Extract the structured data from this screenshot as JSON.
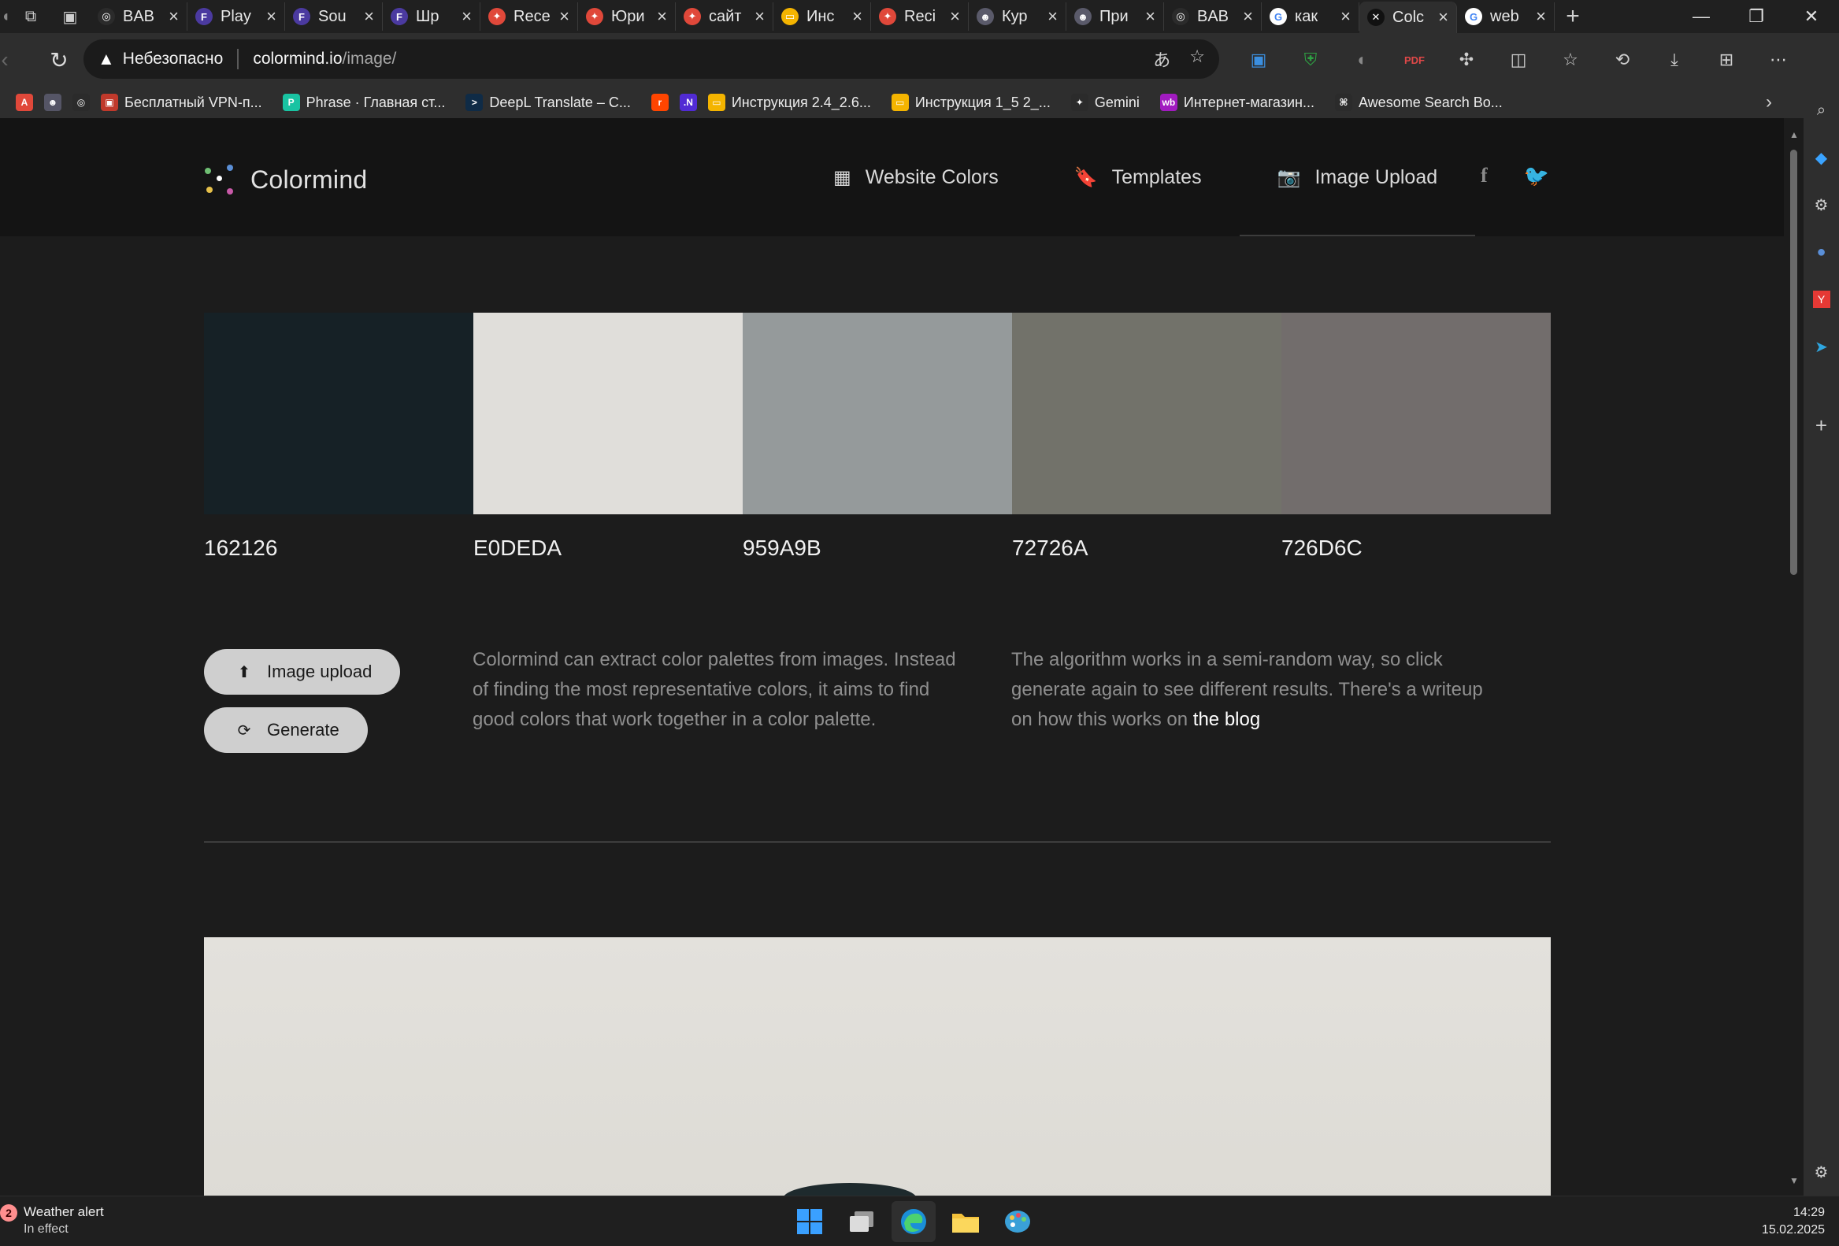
{
  "browser": {
    "tabs": [
      {
        "title": "BAB",
        "fav_color": "#2b2b2b",
        "fav_glyph": "◎",
        "fav_icon": "globe-icon"
      },
      {
        "title": "Play",
        "fav_color": "#4b3aa0",
        "fav_glyph": "F",
        "fav_icon": "framer-icon"
      },
      {
        "title": "Sou",
        "fav_color": "#4b3aa0",
        "fav_glyph": "F",
        "fav_icon": "framer-icon"
      },
      {
        "title": "Шр",
        "fav_color": "#4b3aa0",
        "fav_glyph": "F",
        "fav_icon": "framer-icon"
      },
      {
        "title": "Rece",
        "fav_color": "#e0483a",
        "fav_glyph": "✦",
        "fav_icon": "figma-icon"
      },
      {
        "title": "Юри",
        "fav_color": "#e0483a",
        "fav_glyph": "✦",
        "fav_icon": "figma-icon"
      },
      {
        "title": "сайт",
        "fav_color": "#e0483a",
        "fav_glyph": "✦",
        "fav_icon": "figma-icon"
      },
      {
        "title": "Инс",
        "fav_color": "#f4b400",
        "fav_glyph": "▭",
        "fav_icon": "slides-icon"
      },
      {
        "title": "Reci",
        "fav_color": "#e0483a",
        "fav_glyph": "✦",
        "fav_icon": "figma-icon"
      },
      {
        "title": "Кур",
        "fav_color": "#5a5a6a",
        "fav_glyph": "☻",
        "fav_icon": "mascot-icon"
      },
      {
        "title": "При",
        "fav_color": "#5a5a6a",
        "fav_glyph": "☻",
        "fav_icon": "mascot-icon"
      },
      {
        "title": "BAB",
        "fav_color": "#2b2b2b",
        "fav_glyph": "◎",
        "fav_icon": "globe-icon"
      },
      {
        "title": "как",
        "fav_color": "#ffffff",
        "fav_glyph": "G",
        "fav_icon": "google-icon"
      },
      {
        "title": "Colc",
        "fav_color": "#111111",
        "fav_glyph": "✕",
        "fav_icon": "colormind-icon",
        "active": true
      },
      {
        "title": "web",
        "fav_color": "#ffffff",
        "fav_glyph": "G",
        "fav_icon": "google-icon"
      }
    ],
    "address": {
      "security_label": "Небезопасно",
      "host": "colormind.io",
      "path": "/image/"
    },
    "bookmarks": [
      {
        "label": "",
        "color": "#e0483a",
        "glyph": "A"
      },
      {
        "label": "",
        "color": "#555566",
        "glyph": "☻"
      },
      {
        "label": "",
        "color": "#2b2b2b",
        "glyph": "◎"
      },
      {
        "label": "Бесплатный VPN-п...",
        "color": "#c0392b",
        "glyph": "▣"
      },
      {
        "label": "Phrase · Главная ст...",
        "color": "#19c3a2",
        "glyph": "P"
      },
      {
        "label": "DeepL Translate – C...",
        "color": "#0f2b46",
        "glyph": ">"
      },
      {
        "label": "",
        "color": "#ff4500",
        "glyph": "r"
      },
      {
        "label": "",
        "color": "#512bd4",
        "glyph": ".N"
      },
      {
        "label": "Инструкция 2.4_2.6...",
        "color": "#f4b400",
        "glyph": "▭"
      },
      {
        "label": "Инструкция 1_5 2_...",
        "color": "#f4b400",
        "glyph": "▭"
      },
      {
        "label": "Gemini",
        "color": "#2b2b2b",
        "glyph": "✦"
      },
      {
        "label": "Интернет-магазин...",
        "color": "#a11bc0",
        "glyph": "wb"
      },
      {
        "label": "Awesome Search Bo...",
        "color": "#2b2b2b",
        "glyph": "⌘"
      }
    ]
  },
  "site": {
    "brand": "Colormind",
    "nav": [
      {
        "label": "Website Colors",
        "icon": "grid-icon",
        "glyph": "▦"
      },
      {
        "label": "Templates",
        "icon": "bookmark-icon",
        "glyph": "🔖"
      },
      {
        "label": "Image Upload",
        "icon": "camera-icon",
        "glyph": "📷",
        "active": true
      }
    ],
    "palette": [
      {
        "hex": "162126",
        "color": "#162126"
      },
      {
        "hex": "E0DEDA",
        "color": "#E0DEDA"
      },
      {
        "hex": "959A9B",
        "color": "#959A9B"
      },
      {
        "hex": "72726A",
        "color": "#72726A"
      },
      {
        "hex": "726D6C",
        "color": "#726D6C"
      }
    ],
    "buttons": {
      "upload": "Image upload",
      "generate": "Generate"
    },
    "description_1": "Colormind can extract color palettes from images. Instead of finding the most representative colors, it aims to find good colors that work together in a color palette.",
    "description_2_text": "The algorithm works in a semi-random way, so click generate again to see different results. There's a writeup on how this works on ",
    "description_2_link": "the blog"
  },
  "taskbar": {
    "weather_count": "2",
    "weather_title": "Weather alert",
    "weather_status": "In effect",
    "time": "14:29",
    "date": "15.02.2025"
  }
}
